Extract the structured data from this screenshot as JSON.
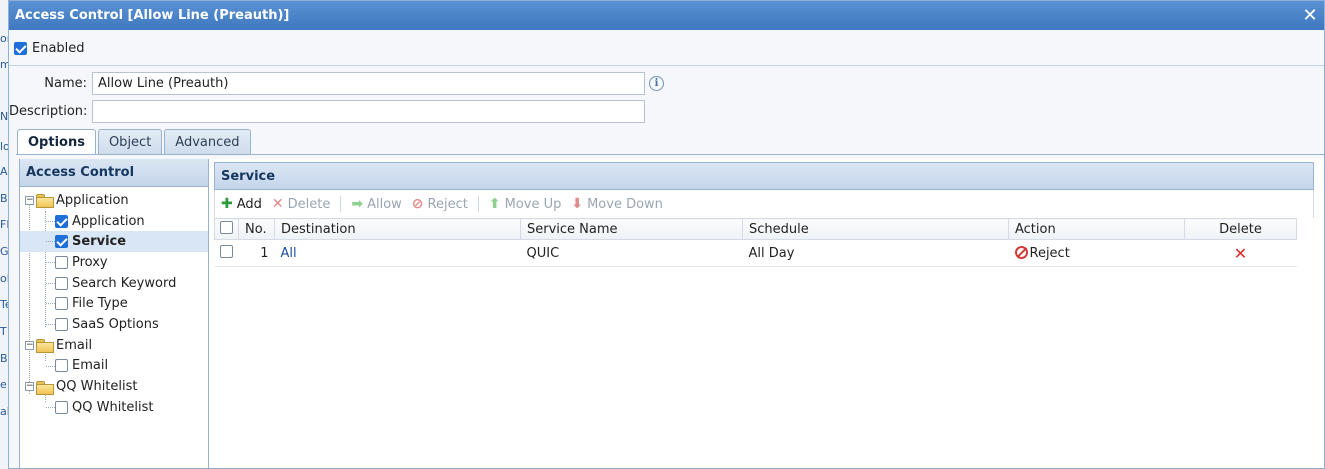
{
  "window": {
    "title": "Access Control [Allow Line (Preauth)]",
    "close_icon": "✕"
  },
  "enabled": {
    "label": "Enabled",
    "checked": true
  },
  "form": {
    "name_label": "Name:",
    "name_value": "Allow Line (Preauth)",
    "description_label": "Description:",
    "description_value": ""
  },
  "tabs": [
    {
      "label": "Options",
      "active": true
    },
    {
      "label": "Object",
      "active": false
    },
    {
      "label": "Advanced",
      "active": false
    }
  ],
  "left_panel": {
    "title": "Access Control",
    "tree": [
      {
        "label": "Application",
        "type": "folder",
        "children": [
          {
            "label": "Application",
            "checked": true
          },
          {
            "label": "Service",
            "checked": true,
            "selected": true
          },
          {
            "label": "Proxy",
            "checked": false
          },
          {
            "label": "Search Keyword",
            "checked": false
          },
          {
            "label": "File Type",
            "checked": false
          },
          {
            "label": "SaaS Options",
            "checked": false
          }
        ]
      },
      {
        "label": "Email",
        "type": "folder",
        "children": [
          {
            "label": "Email",
            "checked": false
          }
        ]
      },
      {
        "label": "QQ Whitelist",
        "type": "folder",
        "children": [
          {
            "label": "QQ Whitelist",
            "checked": false
          }
        ]
      }
    ]
  },
  "right_panel": {
    "title": "Service",
    "toolbar": {
      "add": "Add",
      "delete": "Delete",
      "allow": "Allow",
      "reject": "Reject",
      "move_up": "Move Up",
      "move_down": "Move Down"
    },
    "columns": [
      "No.",
      "Destination",
      "Service Name",
      "Schedule",
      "Action",
      "Delete"
    ],
    "rows": [
      {
        "no": "1",
        "destination": "All",
        "service_name": "QUIC",
        "schedule": "All Day",
        "action": "Reject"
      }
    ]
  },
  "left_edge_fragments": [
    "or",
    "m",
    "N",
    "lo",
    "Al",
    "Bl",
    "FE",
    "G",
    "ol",
    "Te",
    "T",
    "Bl",
    "e",
    "al"
  ],
  "colors": {
    "titlebar": "#4a85cb",
    "accent_blue": "#1e6fd9",
    "reject_red": "#d23a3a"
  }
}
